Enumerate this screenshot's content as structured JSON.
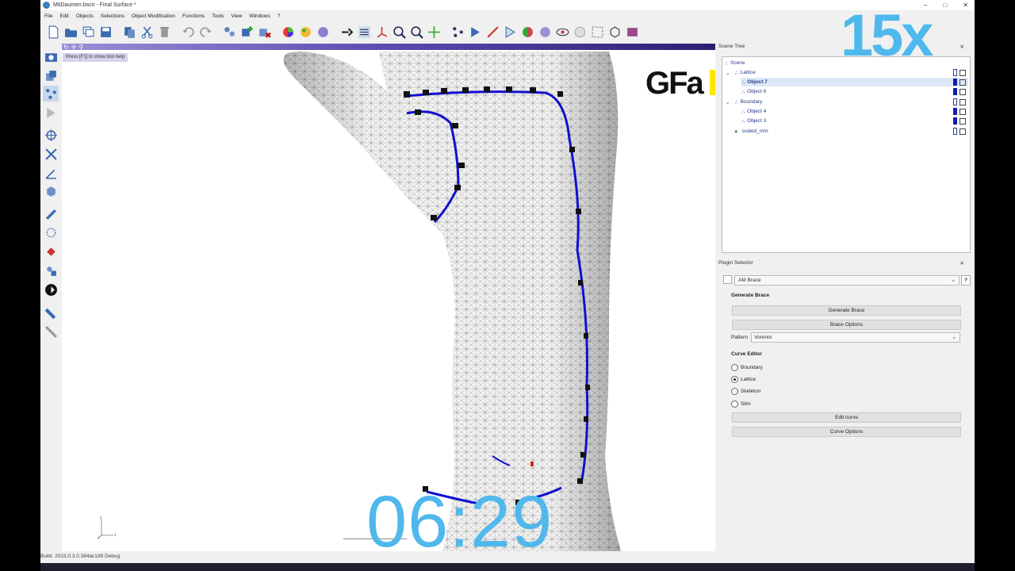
{
  "window": {
    "title": "MitDaumen.bscn - Final Surface *",
    "controls": [
      "–",
      "□",
      "✕"
    ]
  },
  "menu": [
    "File",
    "Edit",
    "Objects",
    "Selections",
    "Object Modification",
    "Functions",
    "Tools",
    "View",
    "Windows",
    "?"
  ],
  "viewport": {
    "help_tip": "Press [F1] to show tool help",
    "logo": "GFa",
    "axes": {
      "y": "y",
      "x": "x",
      "z": "z"
    }
  },
  "scene_tree": {
    "title": "Scene Tree",
    "items": [
      {
        "label": "Scene"
      },
      {
        "label": "Lattice"
      },
      {
        "label": "Object 7"
      },
      {
        "label": "Object 6"
      },
      {
        "label": "Boundary"
      },
      {
        "label": "Object 4"
      },
      {
        "label": "Object 3"
      },
      {
        "label": "scaled_mm"
      }
    ]
  },
  "plugin_selector": {
    "title": "Plugin Selector",
    "selected": "AM Brace",
    "help": "?",
    "generate_title": "Generate Brace",
    "generate_button": "Generate Brace",
    "brace_options_button": "Brace Options",
    "pattern_label": "Pattern",
    "pattern_value": "Voronoi",
    "curve_editor_title": "Curve Editor",
    "curve_options": [
      "Boundary",
      "Lattice",
      "Skeleton",
      "Slim"
    ],
    "curve_selected": "Lattice",
    "edit_curve_button": "Edit curve",
    "curve_options_button": "Curve Options"
  },
  "overlay": {
    "speed": "15x",
    "timer": "06:29"
  },
  "status": {
    "build": "Build: 2023.0.3.0.384ac1d9 Debug"
  },
  "colors": {
    "overlay_text": "#4fb8ec",
    "curve": "#1010d0",
    "logo_bar": "#ffe600"
  }
}
